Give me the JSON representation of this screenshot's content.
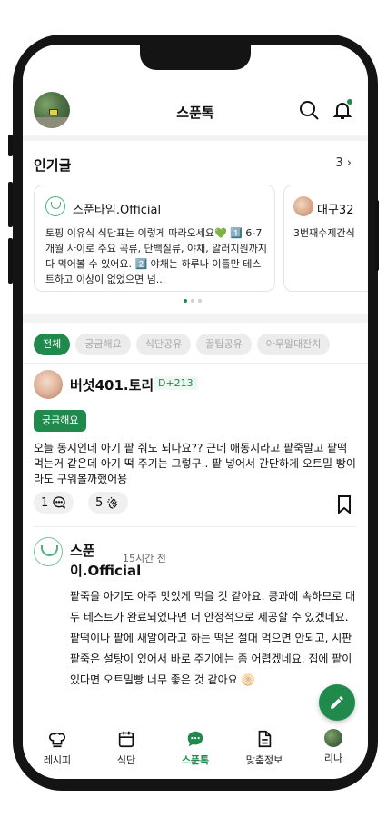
{
  "header": {
    "title": "스푼톡"
  },
  "popular": {
    "title": "인기글",
    "count": "3 ›",
    "cards": [
      {
        "author": "스푼타임.Official",
        "text": "토핑 이유식 식단표는 이렇게 따라오세요💚 1️⃣ 6-7개월 사이로 주요 곡류, 단백질류, 야채, 알러지원까지 다 먹어볼 수 있어요. 2️⃣ 야채는 하루나 이틀만 테스트하고 이상이 없었으면 넘..."
      },
      {
        "author": "대구32",
        "text": "3번째수제간식"
      }
    ]
  },
  "filters": [
    "전체",
    "궁금해요",
    "식단공유",
    "꿀팁공유",
    "아무말대잔치"
  ],
  "post": {
    "author": "버섯401.토리",
    "badge": "D+213",
    "tag": "궁금해요",
    "body": "오늘 동지인데 아기 팥 줘도 되나요?? 근데 애동지라고 팥죽말고 팥떡 먹는거 같은데 아기 떡 주기는 그렇구.. 팥 넣어서 간단하게 오트밀 빵이라도 구워볼까했어용",
    "comments": "1",
    "claps": "5"
  },
  "reply": {
    "author": "스푼이.Official",
    "time": "15시간 전",
    "body": "팥죽을 아기도 아주 맛있게 먹을 것 같아요. 콩과에 속하므로 대두 테스트가 완료되었다면 더 안정적으로 제공할 수 있겠네요. 팥떡이나 팥에 새알이라고 하는 떡은 절대 먹으면 안되고, 시판 팥죽은 설탕이 있어서 바로 주기에는 좀 어렵겠네요. 집에 팥이 있다면 오트밀빵 너무 좋은 것 같아요 🫓"
  },
  "tabs": [
    {
      "label": "레시피",
      "icon": "chef-hat-icon"
    },
    {
      "label": "식단",
      "icon": "calendar-icon"
    },
    {
      "label": "스푼톡",
      "icon": "chat-bubble-icon",
      "active": true
    },
    {
      "label": "맞춤정보",
      "icon": "document-icon"
    },
    {
      "label": "리나",
      "icon": "profile-avatar"
    }
  ],
  "colors": {
    "accent": "#1f8a4c",
    "chip_bg": "#ececec",
    "background": "#f3f3f3"
  }
}
